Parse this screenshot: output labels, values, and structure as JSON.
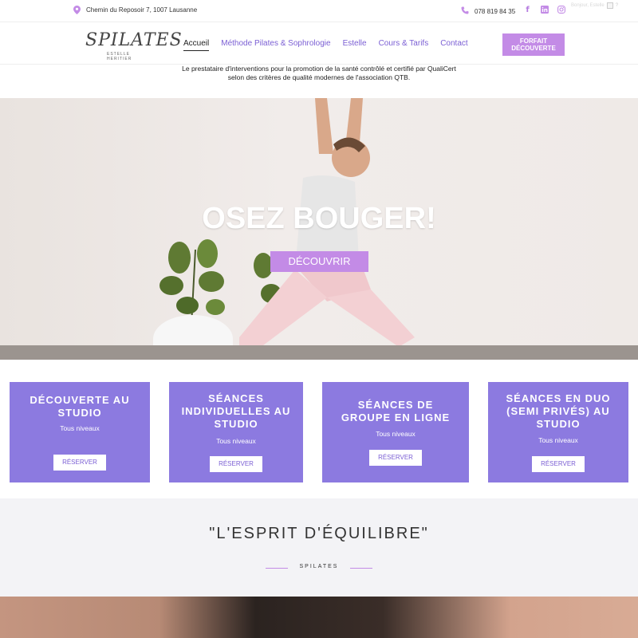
{
  "topbar": {
    "address": "Chemin du Reposoir 7, 1007 Lausanne",
    "phone": "078 819 84 35",
    "social_icons": [
      "facebook-icon",
      "linkedin-icon",
      "instagram-icon"
    ],
    "language": "Bonjour, Estelle"
  },
  "header": {
    "logo_text": "SPILATES",
    "logo_subtext": "ESTELLE HERITIER",
    "nav": [
      {
        "label": "Accueil",
        "active": true
      },
      {
        "label": "Méthode Pilates & Sophrologie",
        "active": false
      },
      {
        "label": "Estelle",
        "active": false
      },
      {
        "label": "Cours & Tarifs",
        "active": false
      },
      {
        "label": "Contact",
        "active": false
      }
    ],
    "cta_line1": "FORFAIT",
    "cta_line2": "DÉCOUVERTE"
  },
  "intro": {
    "line1": "Le prestataire d'interventions pour la promotion de la santé contrôlé et certifié par QualiCert",
    "line2": "selon des critères de qualité modernes de l'association QTB."
  },
  "hero": {
    "title": "OSEZ BOUGER!",
    "button": "DÉCOUVRIR"
  },
  "cards": [
    {
      "title": "DÉCOUVERTE AU STUDIO",
      "level": "Tous niveaux",
      "button": "RÉSERVER"
    },
    {
      "title": "SÉANCES INDIVIDUELLES AU STUDIO",
      "level": "Tous niveaux",
      "button": "RÉSERVER"
    },
    {
      "title": "SÉANCES DE GROUPE EN LIGNE",
      "level": "Tous niveaux",
      "button": "RÉSERVER"
    },
    {
      "title": "SÉANCES EN DUO (SEMI PRIVÉS) AU STUDIO",
      "level": "Tous niveaux",
      "button": "RÉSERVER"
    }
  ],
  "quote": {
    "title": "\"L'ESPRIT D'ÉQUILIBRE\"",
    "subtitle": "SPILATES"
  },
  "colors": {
    "accent": "#c38be6",
    "card": "#8c7ae0",
    "nav_link": "#7b5fd4"
  }
}
